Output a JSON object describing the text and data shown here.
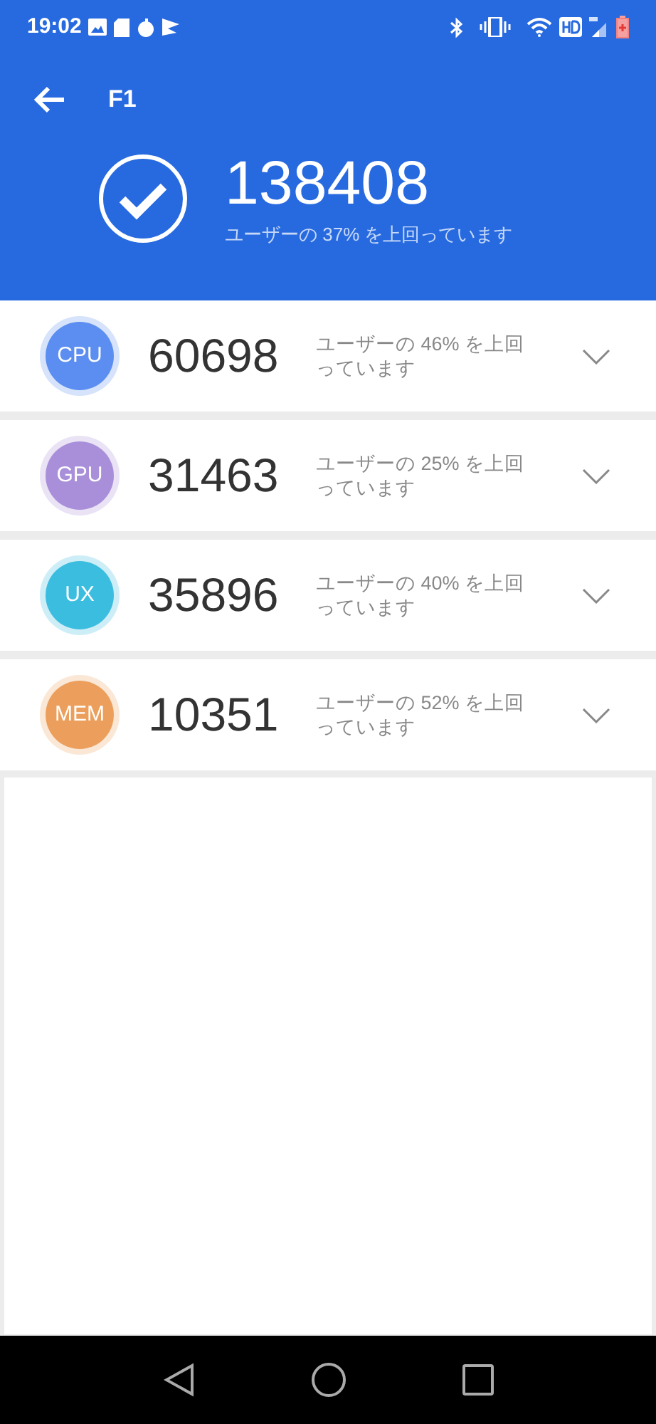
{
  "status_bar": {
    "time": "19:02"
  },
  "header": {
    "title": "F1",
    "score": "138408",
    "caption": "ユーザーの 37% を上回っています"
  },
  "scores": [
    {
      "label": "CPU",
      "color": "#5b8ef0",
      "score": "60698",
      "caption": "ユーザーの 46% を上回っています"
    },
    {
      "label": "GPU",
      "color": "#a98fd9",
      "score": "31463",
      "caption": "ユーザーの 25% を上回っています"
    },
    {
      "label": "UX",
      "color": "#3bbde0",
      "score": "35896",
      "caption": "ユーザーの 40% を上回っています"
    },
    {
      "label": "MEM",
      "color": "#ec9f5c",
      "score": "10351",
      "caption": "ユーザーの 52% を上回っています"
    }
  ]
}
